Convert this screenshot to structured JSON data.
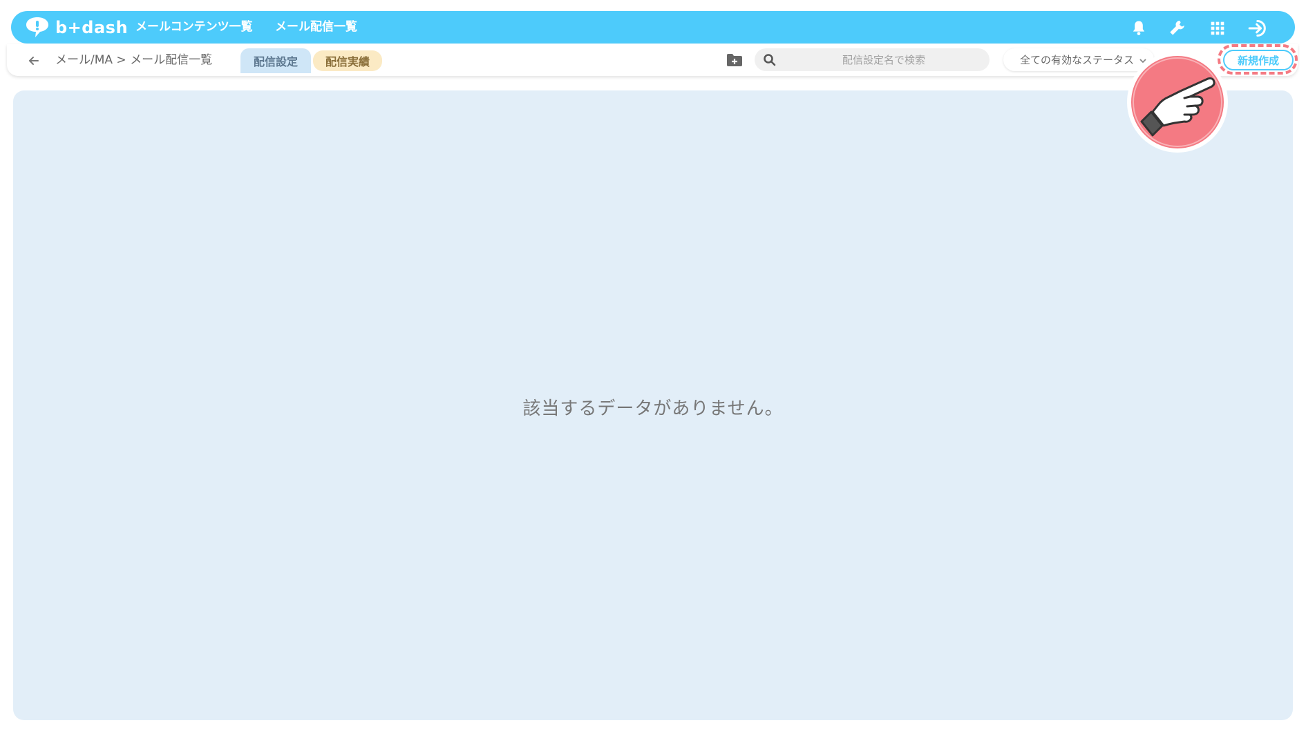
{
  "app": {
    "logo_text": "b+dash",
    "brand_color": "#4dcbfb"
  },
  "header": {
    "nav": [
      {
        "label": "メールコンテンツ一覧"
      },
      {
        "label": "メール配信一覧"
      }
    ],
    "icons": [
      "bell-icon",
      "wrench-icon",
      "grid-apps-icon",
      "logout-icon"
    ]
  },
  "subheader": {
    "breadcrumb": "メール/MA > メール配信一覧",
    "tabs": [
      {
        "label": "配信設定",
        "active": true
      },
      {
        "label": "配信実績",
        "active": false
      }
    ],
    "search": {
      "placeholder": "配信設定名で検索",
      "value": ""
    },
    "status_filter": {
      "selected": "全ての有効なステータス"
    },
    "new_button_label": "新規作成"
  },
  "main": {
    "empty_message": "該当するデータがありません。"
  },
  "annotation": {
    "highlight_color": "#f47a83"
  }
}
